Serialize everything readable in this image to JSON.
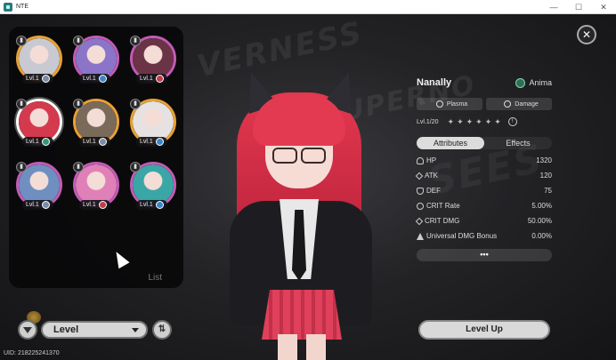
{
  "window": {
    "title": "NTE",
    "minimize": "—",
    "maximize": "☐",
    "close": "✕"
  },
  "roster": {
    "list_label": "List",
    "characters": [
      {
        "level": "Lvl.1",
        "border": "gold",
        "portrait": "#c9c9d2",
        "element_color": "#7b8ca6"
      },
      {
        "level": "Lvl.1",
        "border": "pink",
        "portrait": "#8a75c8",
        "element_color": "#3b86c9"
      },
      {
        "level": "Lvl.1",
        "border": "pink",
        "portrait": "#6b3446",
        "element_color": "#c23b4a"
      },
      {
        "level": "Lvl.1",
        "border": "sel",
        "portrait": "#d43a4e",
        "element_color": "#2f9a78"
      },
      {
        "level": "Lvl.1",
        "border": "gold",
        "portrait": "#7a6a5a",
        "element_color": "#7b8ca6"
      },
      {
        "level": "Lvl.1",
        "border": "gold",
        "portrait": "#e6e2e2",
        "element_color": "#3b86c9"
      },
      {
        "level": "Lvl.1",
        "border": "pink",
        "portrait": "#6f8fc0",
        "element_color": "#7b8ca6"
      },
      {
        "level": "Lvl.1",
        "border": "pink",
        "portrait": "#e080b8",
        "element_color": "#c23b4a"
      },
      {
        "level": "Lvl.1",
        "border": "pink",
        "portrait": "#3aa6a6",
        "element_color": "#3b86c9"
      }
    ]
  },
  "controls": {
    "sort_label": "Level",
    "order_symbol": "⇅",
    "uid": "UID: 218225241370"
  },
  "info": {
    "name": "Nanally",
    "faction": "Anima",
    "tags": [
      "Plasma",
      "Damage"
    ],
    "level_text": "Lvl.1/20",
    "stars": [
      "✦",
      "✦",
      "✦",
      "✦",
      "✦",
      "✦"
    ],
    "tabs": [
      "Attributes",
      "Effects"
    ],
    "stats": [
      {
        "label": "HP",
        "value": "1320"
      },
      {
        "label": "ATK",
        "value": "120"
      },
      {
        "label": "DEF",
        "value": "75"
      },
      {
        "label": "CRIT Rate",
        "value": "5.00%"
      },
      {
        "label": "CRIT DMG",
        "value": "50.00%"
      },
      {
        "label": "Universal DMG Bonus",
        "value": "0.00%"
      }
    ],
    "more": "•••",
    "level_up": "Level Up"
  },
  "close_symbol": "✕",
  "colors": {
    "gold": "#e8a135",
    "pink": "#c35bb6",
    "accent_red": "#e33a52"
  }
}
